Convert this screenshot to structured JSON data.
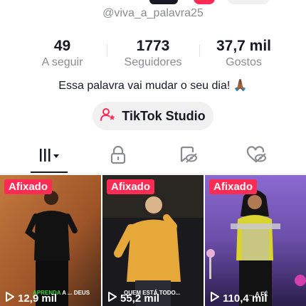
{
  "profile": {
    "handle": "@viva_a_palavra25",
    "bio": "Essa palavra vai mudar o seu dia! 🙏🏾"
  },
  "stats": [
    {
      "value": "49",
      "label": "A seguir"
    },
    {
      "value": "1773",
      "label": "Seguidores"
    },
    {
      "value": "37,7 mil",
      "label": "Gostos"
    }
  ],
  "studio_button": {
    "label": "TikTok Studio",
    "icon": "person-star-icon"
  },
  "tabs": [
    {
      "name": "videos",
      "icon": "grid-bars-dropdown-icon",
      "active": true
    },
    {
      "name": "private",
      "icon": "lock-icon",
      "active": false
    },
    {
      "name": "reposts",
      "icon": "bookmark-eye-off-icon",
      "active": false
    },
    {
      "name": "liked",
      "icon": "heart-eye-off-icon",
      "active": false
    }
  ],
  "videos": [
    {
      "pinned_label": "Afixado",
      "views": "12,9 mil",
      "caption_green": "APRENDA",
      "caption_white": "A ... DEUS"
    },
    {
      "pinned_label": "Afixado",
      "views": "55,2 mil",
      "caption_green": "",
      "caption_white": "QUEM ESTÁ TODO..."
    },
    {
      "pinned_label": "Afixado",
      "views": "110,4 mil",
      "caption_green": "",
      "caption_white": "... A FÉ"
    }
  ],
  "colors": {
    "accent": "#fe2c55",
    "text": "#161823",
    "muted": "#8a8b91",
    "button_bg": "#f1f1f2"
  }
}
